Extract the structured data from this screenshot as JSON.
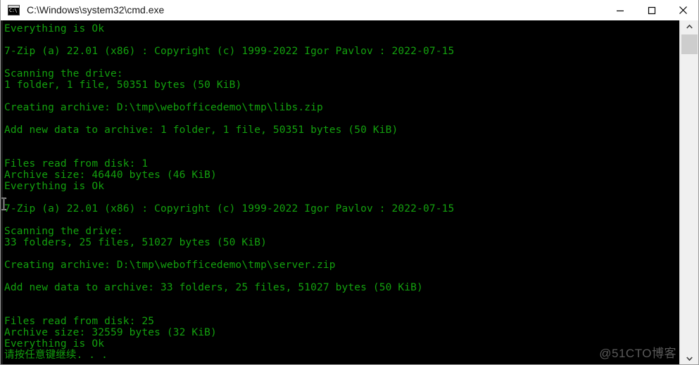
{
  "window": {
    "title": "C:\\Windows\\system32\\cmd.exe",
    "icon": "cmd-console-icon",
    "icon_glyph": "C:\\",
    "background_color": "#000000",
    "titlebar_color": "#ffffff",
    "text_color": "#13a10e",
    "controls": {
      "minimize_label": "Minimize",
      "maximize_label": "Maximize",
      "close_label": "Close"
    }
  },
  "scrollbar": {
    "up_arrow_label": "Scroll up",
    "down_arrow_label": "Scroll down",
    "thumb_label": "Scroll thumb"
  },
  "watermark": {
    "text": "@51CTO博客",
    "color": "#5a5a5a"
  },
  "console": {
    "lines": [
      "Everything is Ok",
      "",
      "7-Zip (a) 22.01 (x86) : Copyright (c) 1999-2022 Igor Pavlov : 2022-07-15",
      "",
      "Scanning the drive:",
      "1 folder, 1 file, 50351 bytes (50 KiB)",
      "",
      "Creating archive: D:\\tmp\\webofficedemo\\tmp\\libs.zip",
      "",
      "Add new data to archive: 1 folder, 1 file, 50351 bytes (50 KiB)",
      "",
      "",
      "Files read from disk: 1",
      "Archive size: 46440 bytes (46 KiB)",
      "Everything is Ok",
      "",
      "7-Zip (a) 22.01 (x86) : Copyright (c) 1999-2022 Igor Pavlov : 2022-07-15",
      "",
      "Scanning the drive:",
      "33 folders, 25 files, 51027 bytes (50 KiB)",
      "",
      "Creating archive: D:\\tmp\\webofficedemo\\tmp\\server.zip",
      "",
      "Add new data to archive: 33 folders, 25 files, 51027 bytes (50 KiB)",
      "",
      "",
      "Files read from disk: 25",
      "Archive size: 32559 bytes (32 KiB)",
      "Everything is Ok",
      "请按任意键继续. . ."
    ]
  }
}
